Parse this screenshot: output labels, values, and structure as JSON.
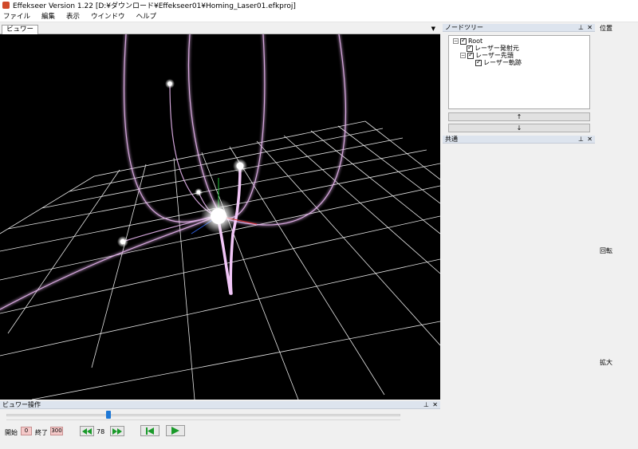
{
  "window": {
    "title": "Effekseer Version 1.22 [D:¥ダウンロード¥Effekseer01¥Homing_Laser01.efkproj]"
  },
  "menu": [
    "ファイル",
    "編集",
    "表示",
    "ウインドウ",
    "ヘルプ"
  ],
  "viewer": {
    "tab_label": "ビュワー",
    "dropdown_icon": "chevron-down-icon"
  },
  "node_tree": {
    "header": "ノードツリー",
    "nodes": [
      {
        "label": "Root",
        "checked": true,
        "level": 0
      },
      {
        "label": "レーザー発射元",
        "checked": true,
        "level": 1
      },
      {
        "label": "レーザー先頭",
        "checked": true,
        "level": 1
      },
      {
        "label": "レーザー軌跡",
        "checked": true,
        "level": 2
      }
    ],
    "up_label": "↑",
    "down_label": "↓"
  },
  "common": {
    "header": "共通"
  },
  "right_labels": {
    "position": "位置",
    "rotation": "回転",
    "scale": "拡大"
  },
  "viewer_ops": {
    "header": "ビュワー操作",
    "start_label": "開始",
    "start_value": "0",
    "end_label": "終了",
    "end_value": "300",
    "frame_value": "78",
    "slider_fraction": 0.26
  },
  "colors": {
    "viewport_bg": "#000000",
    "laser": "#e8b6f0",
    "grid": "#ffffff",
    "panel_header": "#dde4ee"
  }
}
